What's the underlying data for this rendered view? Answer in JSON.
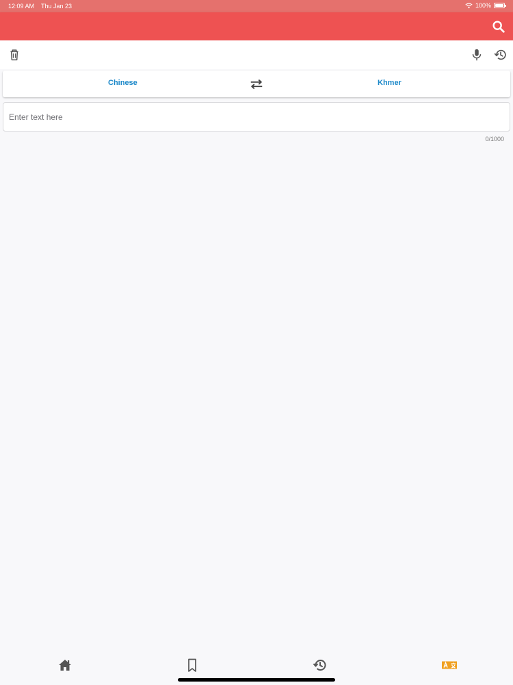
{
  "status_bar": {
    "time": "12:09 AM",
    "date": "Thu Jan 23",
    "battery": "100%"
  },
  "app_bar": {
    "color": "#ee5252",
    "actions": [
      "search-icon"
    ]
  },
  "toolbar": {
    "left_actions": [
      "trash-icon"
    ],
    "right_actions": [
      "microphone-icon",
      "history-icon"
    ]
  },
  "languages": {
    "source": "Chinese",
    "target": "Khmer",
    "swap_icon": "swap-arrows-icon",
    "accent": "#1b88c9"
  },
  "input": {
    "placeholder": "Enter text here",
    "value": "",
    "counter": "0/1000"
  },
  "bottom_nav": {
    "items": [
      "home-icon",
      "bookmark-icon",
      "history-icon",
      "translate-icon"
    ],
    "active_color": "#f0a020"
  }
}
